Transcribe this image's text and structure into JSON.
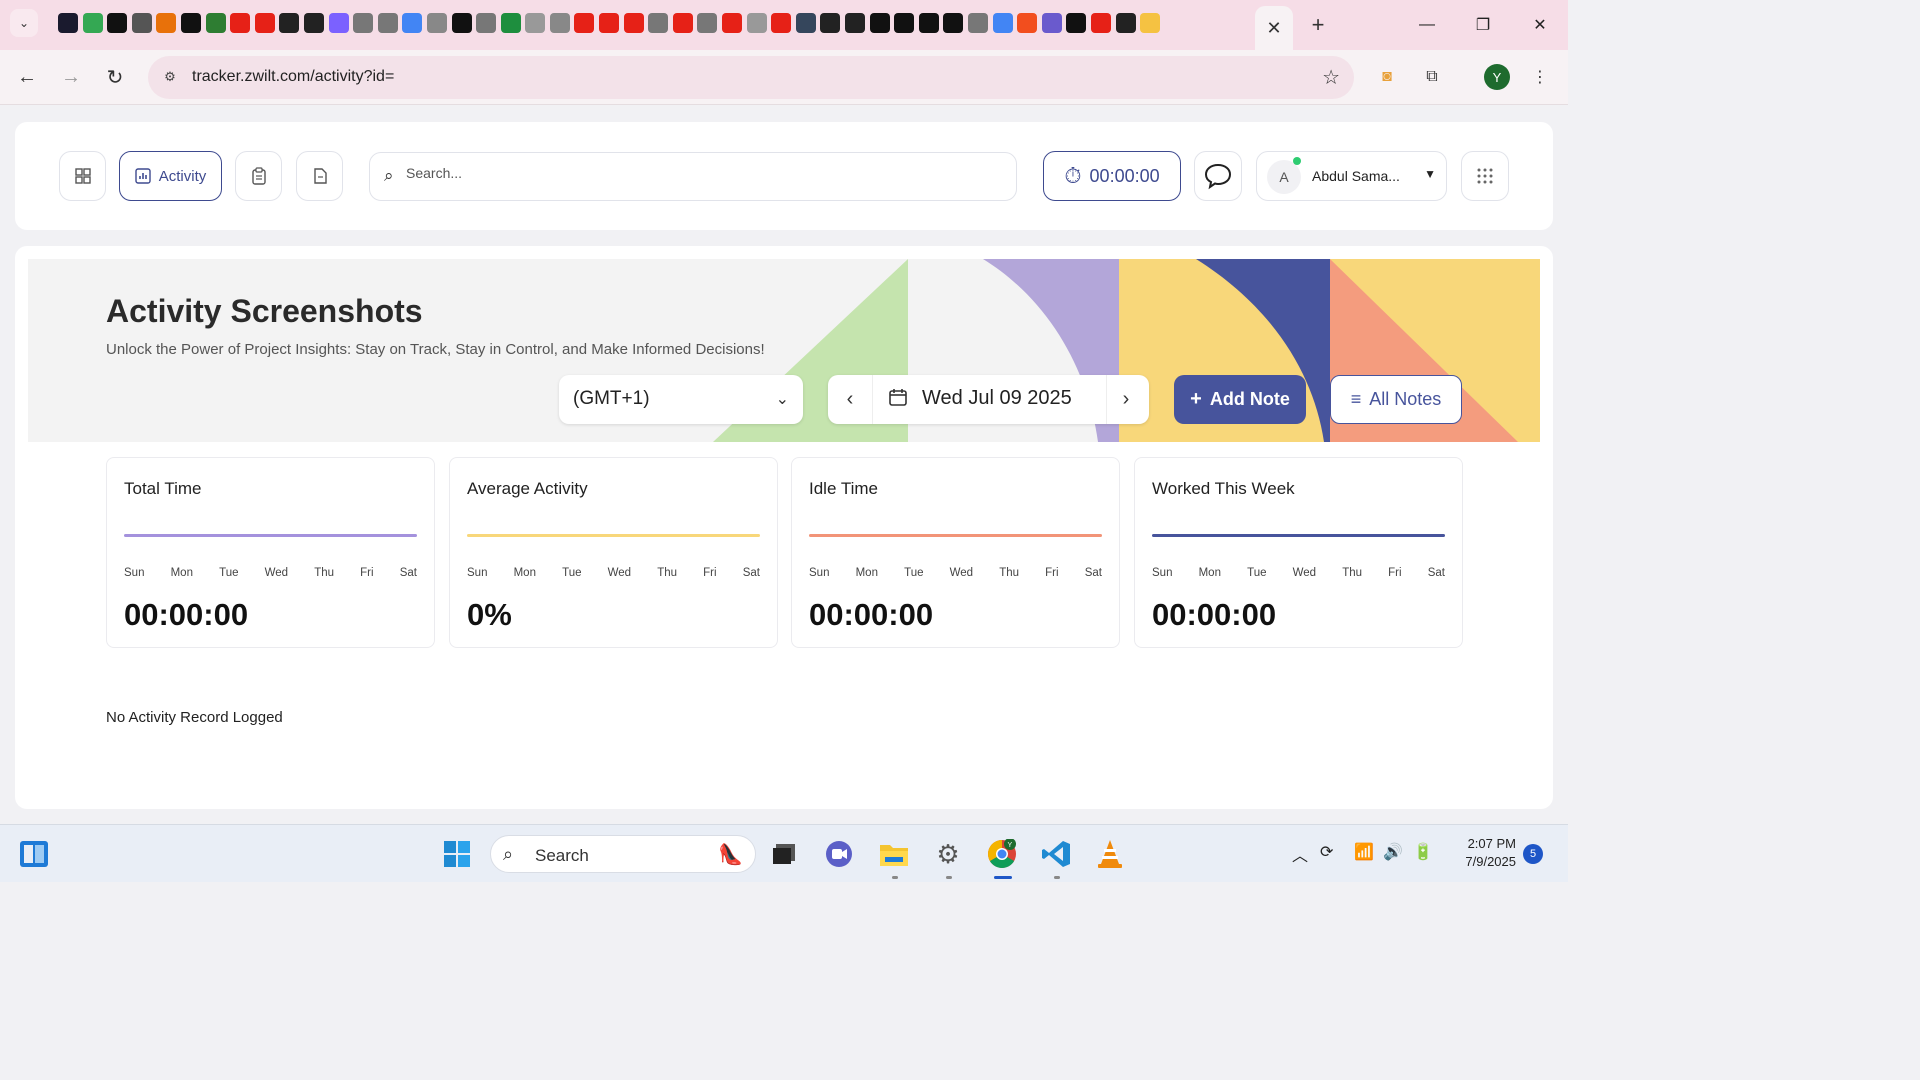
{
  "browser": {
    "url": "tracker.zwilt.com/activity?id=",
    "active_tab_close": "✕",
    "new_tab": "+",
    "pinned_tabs": [
      {
        "icon": "tab-icon-ai",
        "color": "#1a1a2e"
      },
      {
        "icon": "tab-icon-meet",
        "color": "#34a853"
      },
      {
        "icon": "tab-icon-app",
        "color": "#111111"
      },
      {
        "icon": "tab-icon-s",
        "color": "#555555"
      },
      {
        "icon": "tab-icon-bolt",
        "color": "#e8710a"
      },
      {
        "icon": "tab-icon-medium",
        "color": "#111111"
      },
      {
        "icon": "tab-icon-ce",
        "color": "#2e7d32"
      },
      {
        "icon": "tab-icon-youtube",
        "color": "#e62117"
      },
      {
        "icon": "tab-icon-youtube",
        "color": "#e62117"
      },
      {
        "icon": "tab-icon-openai",
        "color": "#222222"
      },
      {
        "icon": "tab-icon-openai",
        "color": "#222222"
      },
      {
        "icon": "tab-icon-pixelart",
        "color": "#7b61ff"
      },
      {
        "icon": "tab-icon-globe",
        "color": "#777777"
      },
      {
        "icon": "tab-icon-globe",
        "color": "#777777"
      },
      {
        "icon": "tab-icon-docs",
        "color": "#4285f4"
      },
      {
        "icon": "tab-icon-play",
        "color": "#888888"
      },
      {
        "icon": "tab-icon-nano",
        "color": "#111111"
      },
      {
        "icon": "tab-icon-linkedin",
        "color": "#777777"
      },
      {
        "icon": "tab-icon-sheets",
        "color": "#1e8e3e"
      },
      {
        "icon": "tab-icon-spark",
        "color": "#999999"
      },
      {
        "icon": "tab-icon-play",
        "color": "#888888"
      },
      {
        "icon": "tab-icon-youtube",
        "color": "#e62117"
      },
      {
        "icon": "tab-icon-youtube",
        "color": "#e62117"
      },
      {
        "icon": "tab-icon-youtube",
        "color": "#e62117"
      },
      {
        "icon": "tab-icon-globe",
        "color": "#777777"
      },
      {
        "icon": "tab-icon-youtube",
        "color": "#e62117"
      },
      {
        "icon": "tab-icon-globe",
        "color": "#777777"
      },
      {
        "icon": "tab-icon-youtube",
        "color": "#e62117"
      },
      {
        "icon": "tab-icon-google",
        "color": "#999999"
      },
      {
        "icon": "tab-icon-youtube",
        "color": "#e62117"
      },
      {
        "icon": "tab-icon-tumblr",
        "color": "#35465c"
      },
      {
        "icon": "tab-icon-github",
        "color": "#222222"
      },
      {
        "icon": "tab-icon-github",
        "color": "#222222"
      },
      {
        "icon": "tab-icon-triangle",
        "color": "#111111"
      },
      {
        "icon": "tab-icon-notion",
        "color": "#111111"
      },
      {
        "icon": "tab-icon-notion",
        "color": "#111111"
      },
      {
        "icon": "tab-icon-nano",
        "color": "#111111"
      },
      {
        "icon": "tab-icon-globe",
        "color": "#777777"
      },
      {
        "icon": "tab-icon-google",
        "color": "#4285f4"
      },
      {
        "icon": "tab-icon-figma",
        "color": "#f24e1e"
      },
      {
        "icon": "tab-icon-a",
        "color": "#6a5acd"
      },
      {
        "icon": "tab-icon-triangle",
        "color": "#111111"
      },
      {
        "icon": "tab-icon-youtube",
        "color": "#e62117"
      },
      {
        "icon": "tab-icon-github",
        "color": "#222222"
      },
      {
        "icon": "tab-icon-claude",
        "color": "#f5c242"
      }
    ]
  },
  "app": {
    "nav": {
      "activity_label": "Activity"
    },
    "search_placeholder": "Search...",
    "timer": "00:00:00",
    "user": {
      "initial": "A",
      "name": "Abdul Sama..."
    }
  },
  "page": {
    "title": "Activity Screenshots",
    "subtitle": "Unlock the Power of Project Insights: Stay on Track, Stay in Control, and Make Informed Decisions!",
    "timezone": "(GMT+1)",
    "date": "Wed Jul 09 2025",
    "add_note_label": "Add Note",
    "all_notes_label": "All Notes",
    "banner_colors": {
      "green": "#c5e4ae",
      "purple": "#b3a6d9",
      "yellow": "#f8d77a",
      "navy": "#47549c",
      "salmon": "#f49c7e"
    },
    "stats": [
      {
        "title": "Total Time",
        "value": "00:00:00",
        "color": "#a492dd",
        "days": [
          "Sun",
          "Mon",
          "Tue",
          "Wed",
          "Thu",
          "Fri",
          "Sat"
        ]
      },
      {
        "title": "Average Activity",
        "value": "0%",
        "color": "#f8d77a",
        "days": [
          "Sun",
          "Mon",
          "Tue",
          "Wed",
          "Thu",
          "Fri",
          "Sat"
        ]
      },
      {
        "title": "Idle Time",
        "value": "00:00:00",
        "color": "#f29478",
        "days": [
          "Sun",
          "Mon",
          "Tue",
          "Wed",
          "Thu",
          "Fri",
          "Sat"
        ]
      },
      {
        "title": "Worked This Week",
        "value": "00:00:00",
        "color": "#47549c",
        "days": [
          "Sun",
          "Mon",
          "Tue",
          "Wed",
          "Thu",
          "Fri",
          "Sat"
        ]
      }
    ],
    "empty_message": "No Activity Record Logged"
  },
  "taskbar": {
    "search_label": "Search",
    "time": "2:07 PM",
    "date": "7/9/2025",
    "notification_count": "5"
  }
}
